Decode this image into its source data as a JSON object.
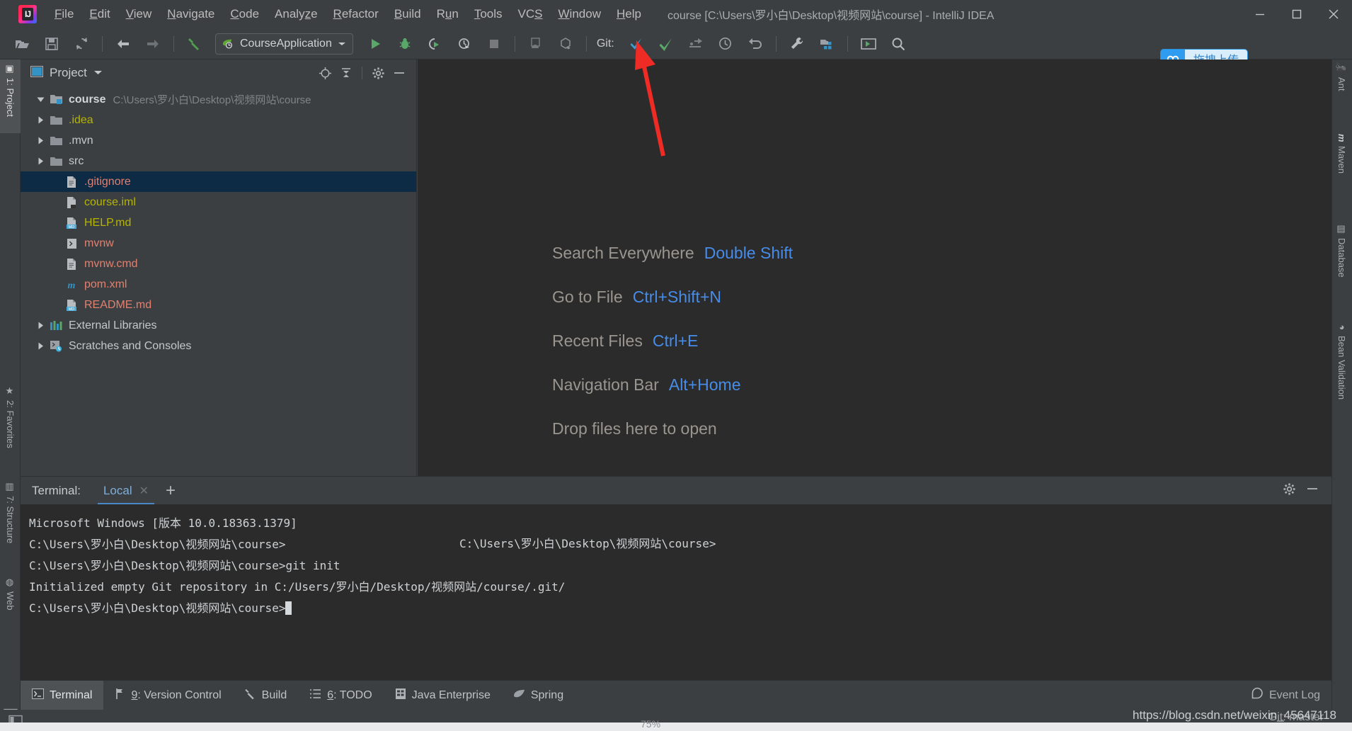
{
  "window": {
    "title": "course [C:\\Users\\罗小白\\Desktop\\视频网站\\course] - IntelliJ IDEA",
    "logo_text": "IJ",
    "controls": {
      "minimize": "minimize-icon",
      "maximize": "maximize-icon",
      "close": "close-icon"
    }
  },
  "menu": [
    {
      "label": "File",
      "mnemonic": "F"
    },
    {
      "label": "Edit",
      "mnemonic": "E"
    },
    {
      "label": "View",
      "mnemonic": "V"
    },
    {
      "label": "Navigate",
      "mnemonic": "N"
    },
    {
      "label": "Code",
      "mnemonic": "C"
    },
    {
      "label": "Analyze",
      "mnemonic": "z"
    },
    {
      "label": "Refactor",
      "mnemonic": "R"
    },
    {
      "label": "Build",
      "mnemonic": "B"
    },
    {
      "label": "Run",
      "mnemonic": "u"
    },
    {
      "label": "Tools",
      "mnemonic": "T"
    },
    {
      "label": "VCS",
      "mnemonic": "S"
    },
    {
      "label": "Window",
      "mnemonic": "W"
    },
    {
      "label": "Help",
      "mnemonic": "H"
    }
  ],
  "toolbar": {
    "icons_left": [
      "open-folder-icon",
      "save-icon",
      "sync-icon",
      "back-arrow-icon",
      "forward-arrow-icon",
      "build-hammer-icon"
    ],
    "run_config": "CourseApplication",
    "run_config_icon": "spring-leaf-run-icon",
    "icons_run": [
      "run-icon",
      "debug-icon",
      "run-with-coverage-icon",
      "profile-icon",
      "stop-icon"
    ],
    "icons_misc": [
      "update-project-icon",
      "package-icon"
    ],
    "git_label": "Git:",
    "git_icons": [
      "update-project-blue-arrow-icon",
      "commit-checkmark-icon",
      "push-icon",
      "history-clock-icon",
      "rollback-icon"
    ],
    "icons_right": [
      "settings-wrench-icon",
      "project-structure-icon",
      "run-anything-icon",
      "search-everywhere-icon"
    ],
    "upload_button": {
      "label": "拖拽上传",
      "icon": "cloud-upload-icon",
      "accent": "#35a7f5"
    }
  },
  "left_strip": [
    {
      "label": "1: Project",
      "mnemonic": "1",
      "icon": "project-icon",
      "active": true
    },
    {
      "label": "2: Favorites",
      "mnemonic": "2",
      "icon": "star-icon",
      "active": false
    },
    {
      "label": "7: Structure",
      "mnemonic": "7",
      "icon": "structure-icon",
      "active": false
    },
    {
      "label": "Web",
      "mnemonic": "",
      "icon": "web-globe-icon",
      "active": false
    }
  ],
  "right_strip": [
    {
      "label": "Ant",
      "icon": "ant-icon"
    },
    {
      "label": "Maven",
      "icon": "maven-m-icon"
    },
    {
      "label": "Database",
      "icon": "database-icon"
    },
    {
      "label": "Bean Validation",
      "icon": "bean-validation-icon"
    }
  ],
  "project_panel": {
    "title": "Project",
    "header_icons": [
      "locate-target-icon",
      "collapse-all-icon",
      "gear-icon",
      "hide-minimize-icon"
    ],
    "tree": [
      {
        "label": "course",
        "path": "C:\\Users\\罗小白\\Desktop\\视频网站\\course",
        "icon": "project-module-folder-icon",
        "indent": 0,
        "expanded": true,
        "style": "bold",
        "selected": false
      },
      {
        "label": ".idea",
        "path": "",
        "icon": "folder-icon",
        "indent": 1,
        "expanded": false,
        "style": "yellow",
        "selected": false
      },
      {
        "label": ".mvn",
        "path": "",
        "icon": "folder-icon",
        "indent": 1,
        "expanded": false,
        "style": "white",
        "selected": false
      },
      {
        "label": "src",
        "path": "",
        "icon": "folder-icon",
        "indent": 1,
        "expanded": false,
        "style": "white",
        "selected": false
      },
      {
        "label": ".gitignore",
        "path": "",
        "icon": "text-file-icon",
        "indent": 2,
        "expanded": null,
        "style": "red",
        "selected": true
      },
      {
        "label": "course.iml",
        "path": "",
        "icon": "iml-file-icon",
        "indent": 2,
        "expanded": null,
        "style": "yellow",
        "selected": false
      },
      {
        "label": "HELP.md",
        "path": "",
        "icon": "markdown-file-icon",
        "indent": 2,
        "expanded": null,
        "style": "yellow",
        "selected": false
      },
      {
        "label": "mvnw",
        "path": "",
        "icon": "shell-script-icon",
        "indent": 2,
        "expanded": null,
        "style": "red",
        "selected": false
      },
      {
        "label": "mvnw.cmd",
        "path": "",
        "icon": "text-file-icon",
        "indent": 2,
        "expanded": null,
        "style": "red",
        "selected": false
      },
      {
        "label": "pom.xml",
        "path": "",
        "icon": "maven-pom-icon",
        "indent": 2,
        "expanded": null,
        "style": "red",
        "selected": false
      },
      {
        "label": "README.md",
        "path": "",
        "icon": "markdown-file-icon",
        "indent": 2,
        "expanded": null,
        "style": "red",
        "selected": false
      },
      {
        "label": "External Libraries",
        "path": "",
        "icon": "libraries-icon",
        "indent": 0,
        "expanded": false,
        "style": "white",
        "selected": false
      },
      {
        "label": "Scratches and Consoles",
        "path": "",
        "icon": "scratches-icon",
        "indent": 0,
        "expanded": false,
        "style": "white",
        "selected": false
      }
    ]
  },
  "editor": {
    "shortcuts": [
      {
        "action": "Search Everywhere",
        "key": "Double Shift"
      },
      {
        "action": "Go to File",
        "key": "Ctrl+Shift+N"
      },
      {
        "action": "Recent Files",
        "key": "Ctrl+E"
      },
      {
        "action": "Navigation Bar",
        "key": "Alt+Home"
      },
      {
        "action": "Drop files here to open",
        "key": ""
      }
    ],
    "annotation_arrow_color": "#ee2b24"
  },
  "terminal": {
    "label": "Terminal:",
    "tab": "Local",
    "close_icon": "close-icon",
    "add_icon": "plus-icon",
    "header_right_icons": [
      "gear-icon",
      "hide-minimize-icon"
    ],
    "lines": [
      "Microsoft Windows [版本 10.0.18363.1379]",
      "",
      "C:\\Users\\罗小白\\Desktop\\视频网站\\course>",
      "C:\\Users\\罗小白\\Desktop\\视频网站\\course>git init",
      "Initialized empty Git repository in C:/Users/罗小白/Desktop/视频网站/course/.git/",
      ""
    ],
    "prompt": "C:\\Users\\罗小白\\Desktop\\视频网站\\course>",
    "floating_path": "C:\\Users\\罗小白\\Desktop\\视频网站\\course>"
  },
  "status_tabs": [
    {
      "label": "Terminal",
      "mnemonic": "",
      "icon": "terminal-icon",
      "active": true
    },
    {
      "label": "9: Version Control",
      "mnemonic": "9",
      "icon": "version-control-icon",
      "active": false
    },
    {
      "label": "Build",
      "mnemonic": "",
      "icon": "build-hammer-icon",
      "active": false
    },
    {
      "label": "6: TODO",
      "mnemonic": "6",
      "icon": "todo-list-icon",
      "active": false
    },
    {
      "label": "Java Enterprise",
      "mnemonic": "",
      "icon": "java-enterprise-icon",
      "active": false
    },
    {
      "label": "Spring",
      "mnemonic": "",
      "icon": "spring-leaf-icon",
      "active": false
    }
  ],
  "event_log": {
    "label": "Event Log",
    "icon": "event-log-icon"
  },
  "status_bar": {
    "git_branch": "Git: master",
    "watermark": "https://blog.csdn.net/weixin_45647118",
    "zoom": "75%"
  }
}
